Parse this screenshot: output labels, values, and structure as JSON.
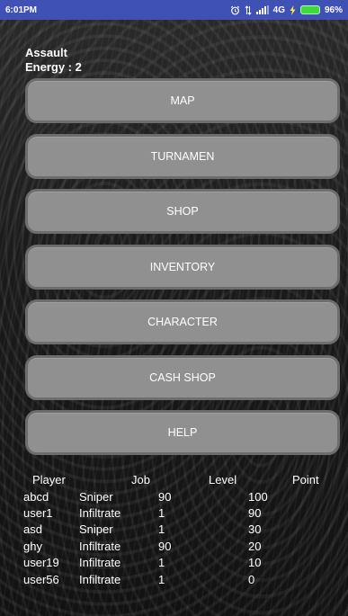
{
  "status_bar": {
    "time": "6:01PM",
    "network": "4G",
    "battery": "96%",
    "icons": [
      "alarm-icon",
      "data-arrows-icon",
      "signal-icon",
      "charging-icon",
      "battery-icon"
    ]
  },
  "header": {
    "title": "Assault",
    "energy": "Energy : 2"
  },
  "menu": {
    "items": [
      {
        "label": "MAP"
      },
      {
        "label": "TURNAMEN"
      },
      {
        "label": "SHOP"
      },
      {
        "label": "INVENTORY"
      },
      {
        "label": "CHARACTER"
      },
      {
        "label": "CASH SHOP"
      },
      {
        "label": "HELP"
      }
    ]
  },
  "leaderboard": {
    "headers": [
      "Player",
      "Job",
      "Level",
      "Point"
    ],
    "rows": [
      [
        "abcd",
        "Sniper",
        "90",
        "100"
      ],
      [
        "user1",
        "Infiltrate",
        "1",
        "90"
      ],
      [
        "asd",
        "Sniper",
        "1",
        "30"
      ],
      [
        "ghy",
        "Infiltrate",
        "90",
        "20"
      ],
      [
        "user19",
        "Infiltrate",
        "1",
        "10"
      ],
      [
        "user56",
        "Infiltrate",
        "1",
        "0"
      ]
    ]
  },
  "colors": {
    "status_bar": "#3f51b5",
    "button": "#909090",
    "button_border": "#6d6d6d",
    "battery": "#3ddc3d"
  }
}
